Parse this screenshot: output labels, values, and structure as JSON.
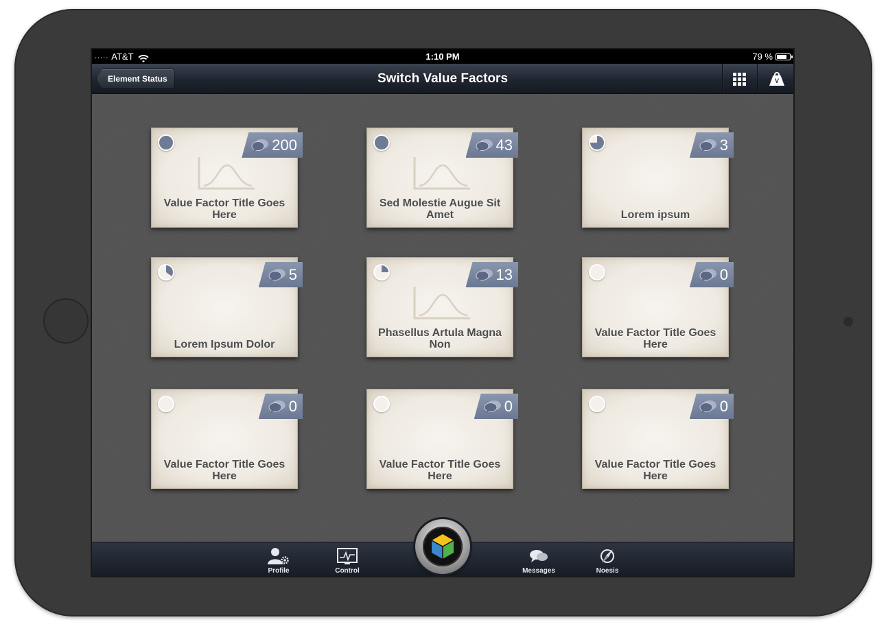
{
  "status_bar": {
    "carrier": "AT&T",
    "signal": ".....",
    "time": "1:10 PM",
    "battery": "79 %",
    "battery_level": 0.79
  },
  "nav_bar": {
    "back_label": "Element Status",
    "title": "Switch Value Factors",
    "right_icons": [
      "grid-icon",
      "weight-icon"
    ],
    "weight_letter": "V"
  },
  "cards": [
    {
      "title": "Value Factor Title Goes Here",
      "comments": "200",
      "progress": 1.0,
      "has_chart": true
    },
    {
      "title": "Sed Molestie Augue Sit Amet",
      "comments": "43",
      "progress": 1.0,
      "has_chart": true
    },
    {
      "title": "Lorem ipsum",
      "comments": "3",
      "progress": 0.75,
      "has_chart": false
    },
    {
      "title": "Lorem Ipsum Dolor",
      "comments": "5",
      "progress": 0.35,
      "has_chart": false
    },
    {
      "title": "Phasellus Artula Magna Non",
      "comments": "13",
      "progress": 0.25,
      "has_chart": true
    },
    {
      "title": "Value Factor Title Goes Here",
      "comments": "0",
      "progress": 0,
      "has_chart": false
    },
    {
      "title": "Value Factor Title Goes Here",
      "comments": "0",
      "progress": 0,
      "has_chart": false
    },
    {
      "title": "Value Factor Title Goes Here",
      "comments": "0",
      "progress": 0,
      "has_chart": false
    },
    {
      "title": "Value Factor Title Goes Here",
      "comments": "0",
      "progress": 0,
      "has_chart": false
    }
  ],
  "tab_bar": {
    "items": [
      {
        "label": "Profile",
        "icon": "profile-gear-icon"
      },
      {
        "label": "Control",
        "icon": "monitor-pulse-icon"
      },
      {
        "label": "Messages",
        "icon": "chat-bubbles-icon"
      },
      {
        "label": "Noesis",
        "icon": "compass-icon"
      }
    ],
    "center_icon": "cube-logo-icon"
  },
  "colors": {
    "ribbon": "#7885a0",
    "progress_fill": "#6f7b95",
    "card_bg": "#f1ede6",
    "title_text": "#4d4d4d"
  }
}
